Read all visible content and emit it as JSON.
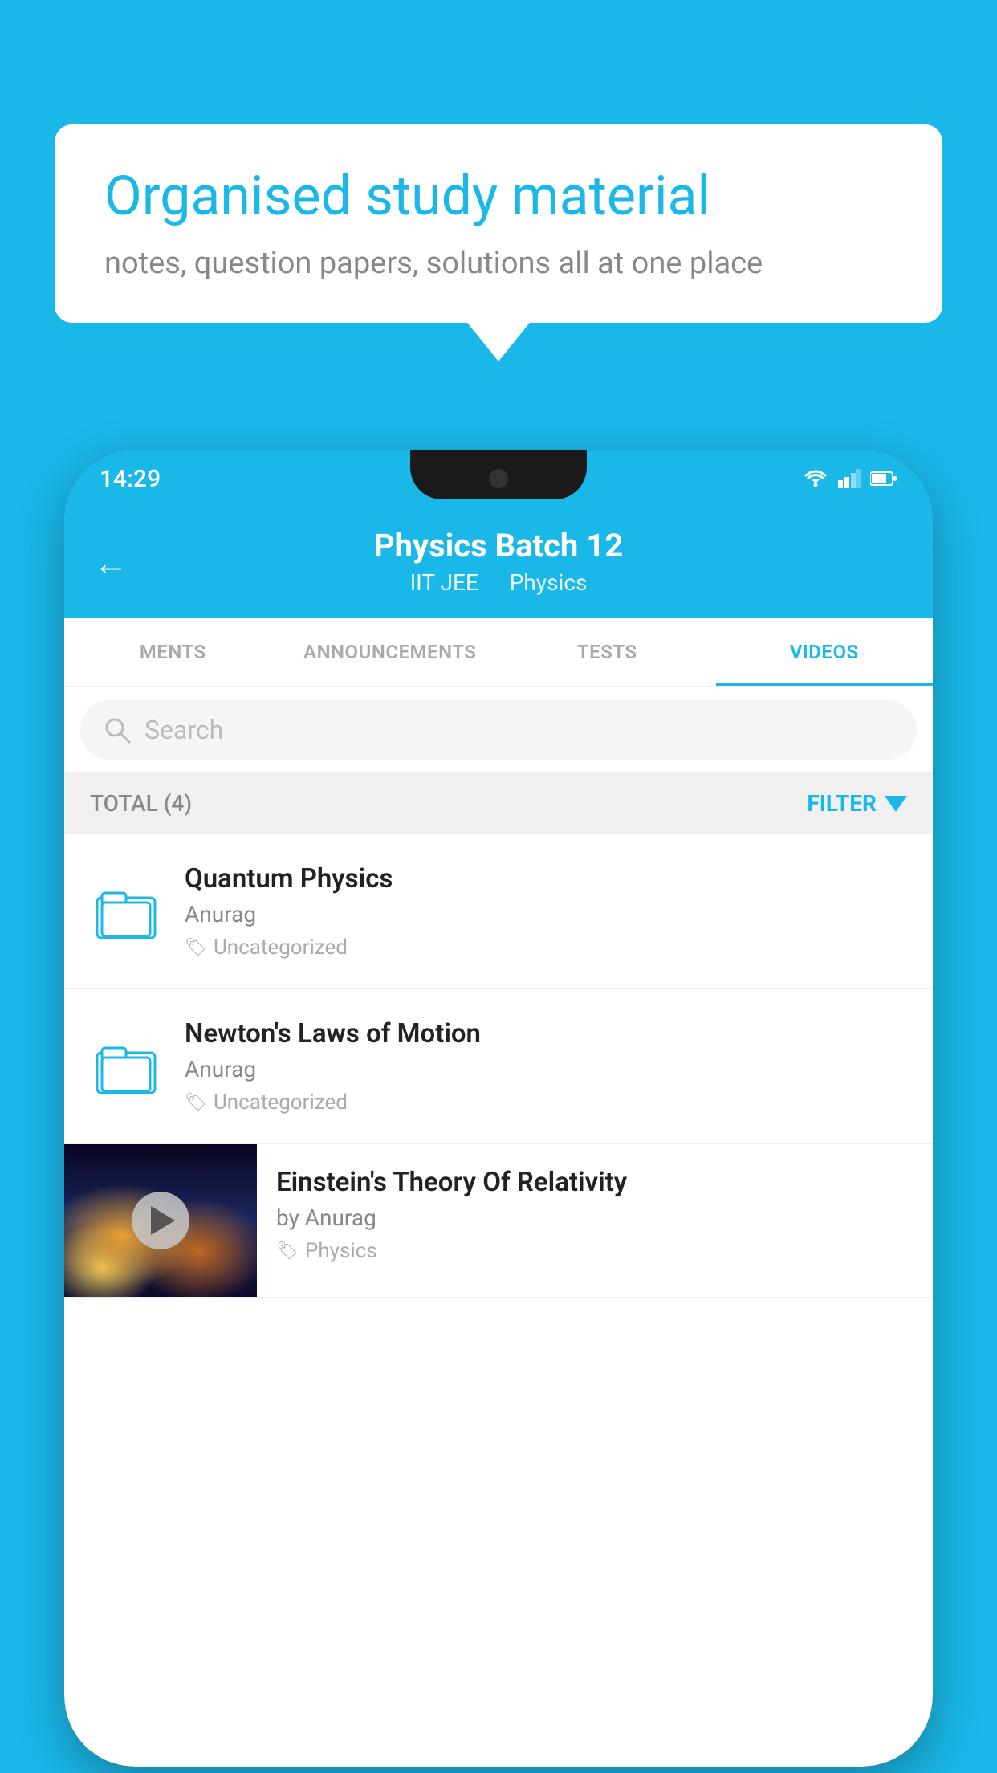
{
  "background_color": "#1ab8e8",
  "speech_bubble": {
    "title": "Organised study material",
    "subtitle": "notes, question papers, solutions all at one place"
  },
  "phone": {
    "status_bar": {
      "time": "14:29"
    },
    "header": {
      "title": "Physics Batch 12",
      "subtitle_left": "IIT JEE",
      "subtitle_right": "Physics",
      "back_label": "←"
    },
    "tabs": [
      {
        "label": "MENTS",
        "active": false
      },
      {
        "label": "ANNOUNCEMENTS",
        "active": false
      },
      {
        "label": "TESTS",
        "active": false
      },
      {
        "label": "VIDEOS",
        "active": true
      }
    ],
    "search": {
      "placeholder": "Search"
    },
    "filter": {
      "total_label": "TOTAL (4)",
      "filter_label": "FILTER"
    },
    "items": [
      {
        "type": "folder",
        "title": "Quantum Physics",
        "author": "Anurag",
        "tag": "Uncategorized"
      },
      {
        "type": "folder",
        "title": "Newton's Laws of Motion",
        "author": "Anurag",
        "tag": "Uncategorized"
      },
      {
        "type": "video",
        "title": "Einstein's Theory Of Relativity",
        "author": "by Anurag",
        "tag": "Physics"
      }
    ]
  }
}
